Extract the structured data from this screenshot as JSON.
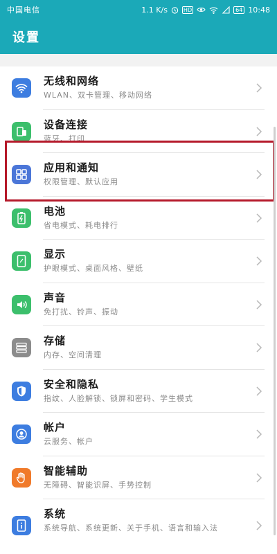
{
  "status_bar": {
    "carrier": "中国电信",
    "speed": "1.1 K/s",
    "hd_badge": "HD",
    "battery_level": "64",
    "time": "10:48"
  },
  "header": {
    "title": "设置"
  },
  "settings": [
    {
      "title": "无线和网络",
      "subtitle": "WLAN、双卡管理、移动网络",
      "icon": "wifi-icon",
      "color": "#3d7de0"
    },
    {
      "title": "设备连接",
      "subtitle": "蓝牙、打印",
      "icon": "device-connect-icon",
      "color": "#3cbf6c"
    },
    {
      "title": "应用和通知",
      "subtitle": "权限管理、默认应用",
      "icon": "apps-icon",
      "color": "#4b76d8"
    },
    {
      "title": "电池",
      "subtitle": "省电模式、耗电排行",
      "icon": "battery-icon",
      "color": "#3cbf6c"
    },
    {
      "title": "显示",
      "subtitle": "护眼模式、桌面风格、壁纸",
      "icon": "display-icon",
      "color": "#3cbf6c"
    },
    {
      "title": "声音",
      "subtitle": "免打扰、铃声、振动",
      "icon": "sound-icon",
      "color": "#3cbf6c"
    },
    {
      "title": "存储",
      "subtitle": "内存、空间清理",
      "icon": "storage-icon",
      "color": "#8c8c8c"
    },
    {
      "title": "安全和隐私",
      "subtitle": "指纹、人脸解锁、锁屏和密码、学生模式",
      "icon": "shield-icon",
      "color": "#3d7de0"
    },
    {
      "title": "帐户",
      "subtitle": "云服务、帐户",
      "icon": "account-icon",
      "color": "#3d7de0"
    },
    {
      "title": "智能辅助",
      "subtitle": "无障碍、智能识屏、手势控制",
      "icon": "hand-icon",
      "color": "#f07a2a"
    },
    {
      "title": "系统",
      "subtitle": "系统导航、系统更新、关于手机、语言和输入法",
      "icon": "system-icon",
      "color": "#3d7de0"
    }
  ],
  "colors": {
    "header": "#1ba9b8",
    "highlight": "#b5192a"
  }
}
